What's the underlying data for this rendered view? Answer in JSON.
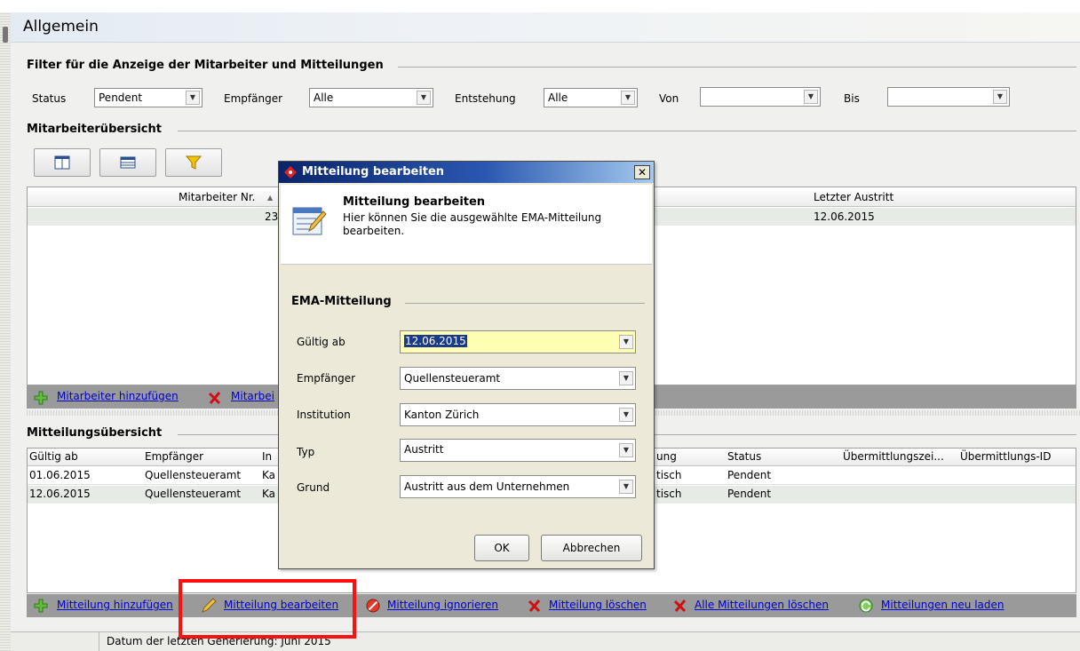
{
  "window": {
    "title": "Allgemein"
  },
  "filter": {
    "section_title": "Filter für die Anzeige der Mitarbeiter und Mitteilungen",
    "status_label": "Status",
    "status_value": "Pendent",
    "empfaenger_label": "Empfänger",
    "empfaenger_value": "Alle",
    "entstehung_label": "Entstehung",
    "entstehung_value": "Alle",
    "von_label": "Von",
    "von_value": "",
    "bis_label": "Bis",
    "bis_value": ""
  },
  "employees": {
    "section_title": "Mitarbeiterübersicht",
    "columns": {
      "nr": "Mitarbeiter Nr.",
      "letzter_austritt": "Letzter Austritt"
    },
    "sort_indicator": "▲",
    "rows": [
      {
        "nr": "23",
        "letzter_austritt": "12.06.2015"
      }
    ],
    "actions": {
      "add": "Mitarbeiter hinzufügen",
      "remove": "Mitarbei"
    }
  },
  "messages": {
    "section_title": "Mitteilungsübersicht",
    "columns": {
      "gueltig_ab": "Gültig ab",
      "empfaenger": "Empfänger",
      "institution": "In",
      "entstehung": "ung",
      "status": "Status",
      "zeitpunkt": "Übermittlungszei...",
      "id": "Übermittlungs-ID"
    },
    "rows": [
      {
        "gueltig_ab": "01.06.2015",
        "empfaenger": "Quellensteueramt",
        "institution": "Ka",
        "entstehung": "tisch",
        "status": "Pendent"
      },
      {
        "gueltig_ab": "12.06.2015",
        "empfaenger": "Quellensteueramt",
        "institution": "Ka",
        "entstehung": "tisch",
        "status": "Pendent"
      }
    ],
    "actions": {
      "add": "Mitteilung hinzufügen",
      "edit": "Mitteilung bearbeiten",
      "ignore": "Mitteilung ignorieren",
      "delete": "Mitteilung löschen",
      "delete_all": "Alle Mitteilungen löschen",
      "reload": "Mitteilungen neu laden"
    }
  },
  "status_bar": {
    "text": "Datum der letzten Generierung: Juni 2015"
  },
  "dialog": {
    "title": "Mitteilung bearbeiten",
    "close": "✕",
    "header_title": "Mitteilung bearbeiten",
    "header_desc": "Hier können Sie die ausgewählte EMA-Mitteilung bearbeiten.",
    "section_title": "EMA-Mitteilung",
    "fields": {
      "gueltig_ab_label": "Gültig ab",
      "gueltig_ab_value": "12.06.2015",
      "empfaenger_label": "Empfänger",
      "empfaenger_value": "Quellensteueramt",
      "institution_label": "Institution",
      "institution_value": "Kanton Zürich",
      "typ_label": "Typ",
      "typ_value": "Austritt",
      "grund_label": "Grund",
      "grund_value": "Austritt aus dem Unternehmen"
    },
    "ok": "OK",
    "cancel": "Abbrechen"
  },
  "icons": {
    "toolbar": [
      "columns-icon",
      "table-icon",
      "filter-icon"
    ],
    "add": "plus-icon",
    "edit": "pencil-icon",
    "ignore": "block-icon",
    "delete": "x-icon",
    "reload": "refresh-icon"
  },
  "colors": {
    "accent": "#0a246a",
    "link": "#0000cc",
    "highlight": "#ff1010"
  }
}
